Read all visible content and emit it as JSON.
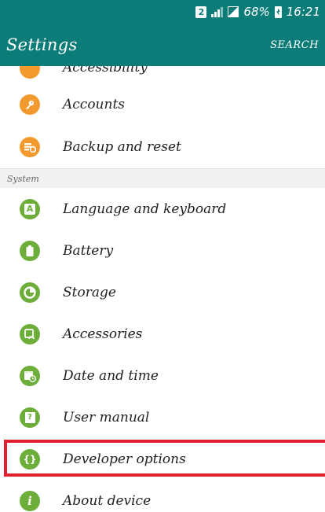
{
  "status_bar": {
    "sim_label": "2",
    "battery_percent": "68%",
    "time": "16:21"
  },
  "app_bar": {
    "title": "Settings",
    "search_label": "SEARCH"
  },
  "partial_item": {
    "label": "Accessibility",
    "icon": "accessibility-icon"
  },
  "items_top": [
    {
      "label": "Accounts",
      "icon": "key-icon"
    },
    {
      "label": "Backup and reset",
      "icon": "backup-icon"
    }
  ],
  "section": {
    "label": "System"
  },
  "system_items": [
    {
      "label": "Language and keyboard",
      "icon": "language-icon",
      "glyph": "A"
    },
    {
      "label": "Battery",
      "icon": "battery-icon",
      "glyph": "▮"
    },
    {
      "label": "Storage",
      "icon": "storage-icon",
      "glyph": "◔"
    },
    {
      "label": "Accessories",
      "icon": "accessories-icon",
      "glyph": "◘"
    },
    {
      "label": "Date and time",
      "icon": "calendar-clock-icon",
      "glyph": "▦"
    },
    {
      "label": "User manual",
      "icon": "manual-icon",
      "glyph": "?"
    },
    {
      "label": "Developer options",
      "icon": "braces-icon",
      "glyph": "{}"
    },
    {
      "label": "About device",
      "icon": "info-icon",
      "glyph": "i"
    }
  ],
  "colors": {
    "bar": "#0c7c79",
    "orange_icon": "#f39a2e",
    "green_icon": "#6dae3a",
    "highlight": "#e0202f"
  }
}
